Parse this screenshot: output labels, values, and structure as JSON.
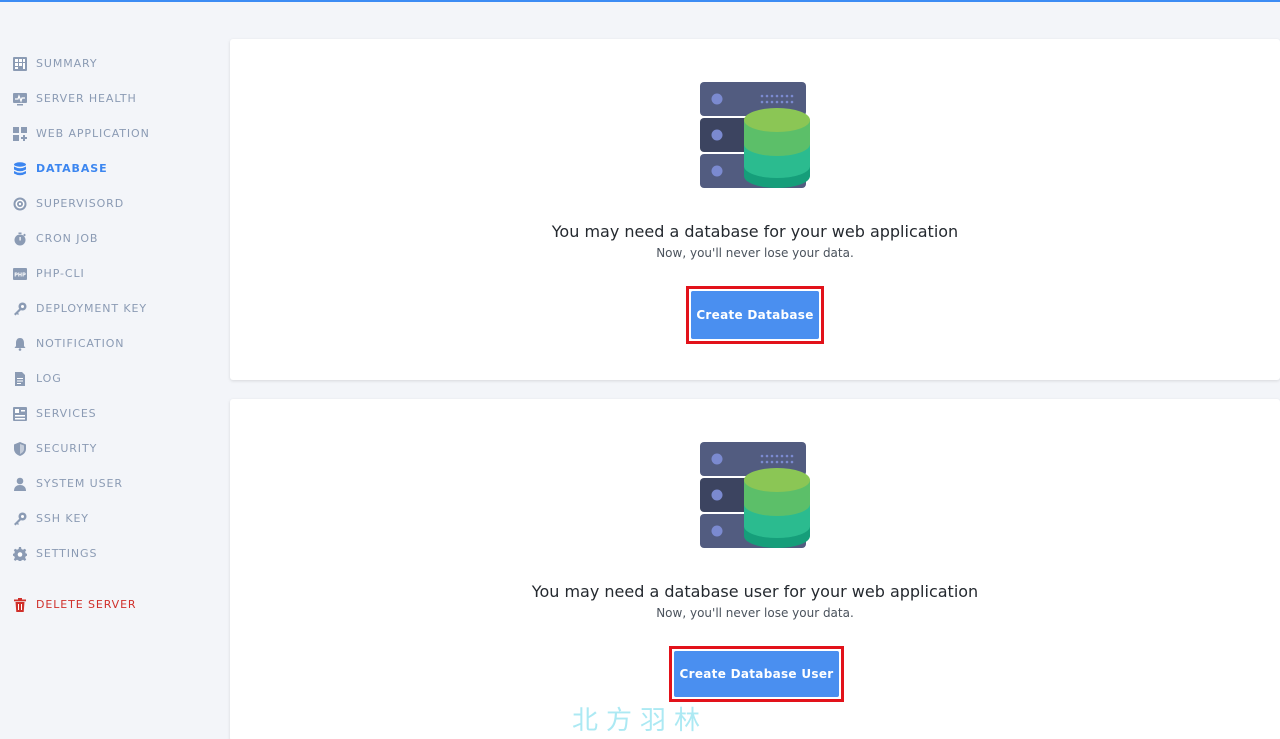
{
  "sidebar": {
    "items": [
      {
        "label": "SUMMARY",
        "icon": "summary-grid-icon"
      },
      {
        "label": "SERVER HEALTH",
        "icon": "monitor-icon"
      },
      {
        "label": "WEB APPLICATION",
        "icon": "apps-icon"
      },
      {
        "label": "DATABASE",
        "icon": "database-icon",
        "active": true
      },
      {
        "label": "SUPERVISORD",
        "icon": "gear-circle-icon"
      },
      {
        "label": "CRON JOB",
        "icon": "stopwatch-icon"
      },
      {
        "label": "PHP-CLI",
        "icon": "php-icon"
      },
      {
        "label": "DEPLOYMENT KEY",
        "icon": "key-icon"
      },
      {
        "label": "NOTIFICATION",
        "icon": "bell-icon"
      },
      {
        "label": "LOG",
        "icon": "document-icon"
      },
      {
        "label": "SERVICES",
        "icon": "services-icon"
      },
      {
        "label": "SECURITY",
        "icon": "shield-icon"
      },
      {
        "label": "SYSTEM USER",
        "icon": "user-icon"
      },
      {
        "label": "SSH KEY",
        "icon": "key-icon"
      },
      {
        "label": "SETTINGS",
        "icon": "gear-icon"
      }
    ],
    "delete": {
      "label": "DELETE SERVER",
      "icon": "trash-icon"
    }
  },
  "cards": [
    {
      "title": "You may need a database for your web application",
      "subtitle": "Now, you'll never lose your data.",
      "button": "Create Database"
    },
    {
      "title": "You may need a database user for your web application",
      "subtitle": "Now, you'll never lose your data.",
      "button": "Create Database User"
    }
  ],
  "watermark": "北方羽林",
  "colors": {
    "accent": "#3c86f0",
    "button": "#4a8ff0",
    "danger": "#d0302b",
    "highlight": "#e2121a",
    "sidebar_text": "#8b9bb4"
  }
}
